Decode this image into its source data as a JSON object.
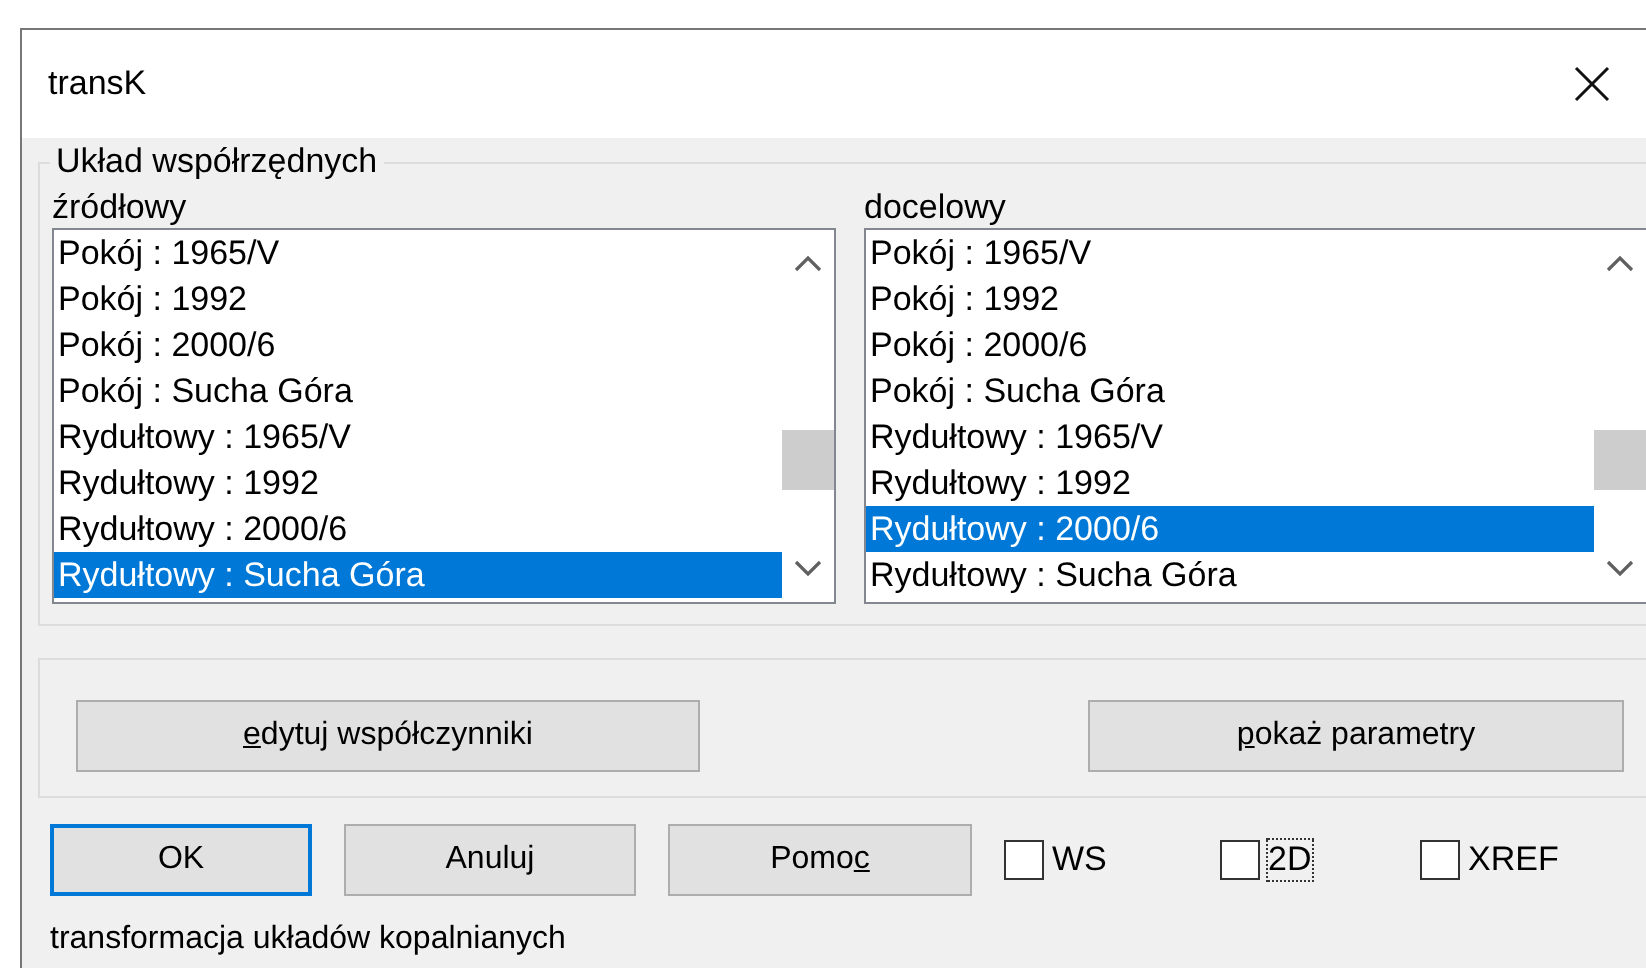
{
  "window": {
    "title": "transK"
  },
  "group": {
    "title": "Układ współrzędnych"
  },
  "lists": [
    {
      "label": "źródłowy",
      "items": [
        {
          "text": "Pokój : 1965/V",
          "selected": false
        },
        {
          "text": "Pokój : 1992",
          "selected": false
        },
        {
          "text": "Pokój : 2000/6",
          "selected": false
        },
        {
          "text": "Pokój : Sucha Góra",
          "selected": false
        },
        {
          "text": "Rydułtowy : 1965/V",
          "selected": false
        },
        {
          "text": "Rydułtowy : 1992",
          "selected": false
        },
        {
          "text": "Rydułtowy : 2000/6",
          "selected": false
        },
        {
          "text": "Rydułtowy : Sucha Góra",
          "selected": true
        }
      ]
    },
    {
      "label": "docelowy",
      "items": [
        {
          "text": "Pokój : 1965/V",
          "selected": false
        },
        {
          "text": "Pokój : 1992",
          "selected": false
        },
        {
          "text": "Pokój : 2000/6",
          "selected": false
        },
        {
          "text": "Pokój : Sucha Góra",
          "selected": false
        },
        {
          "text": "Rydułtowy : 1965/V",
          "selected": false
        },
        {
          "text": "Rydułtowy : 1992",
          "selected": false
        },
        {
          "text": "Rydułtowy : 2000/6",
          "selected": true
        },
        {
          "text": "Rydułtowy : Sucha Góra",
          "selected": false
        }
      ]
    }
  ],
  "action_buttons": [
    {
      "label": "edytuj współczynniki",
      "kind": "leading"
    },
    {
      "label": "pokaż parametry",
      "kind": "leading"
    }
  ],
  "dialog_buttons": [
    {
      "label": "OK",
      "kind": "plain",
      "default": true
    },
    {
      "label": "Anuluj",
      "kind": "plain",
      "default": false
    },
    {
      "label": "Pomoc",
      "kind": "trailing",
      "default": false
    }
  ],
  "checkboxes": [
    {
      "label": "WS",
      "checked": false,
      "focused": false
    },
    {
      "label": "2D",
      "checked": false,
      "focused": true
    },
    {
      "label": "XREF",
      "checked": false,
      "focused": false
    }
  ],
  "status": "transformacja układów kopalnianych"
}
